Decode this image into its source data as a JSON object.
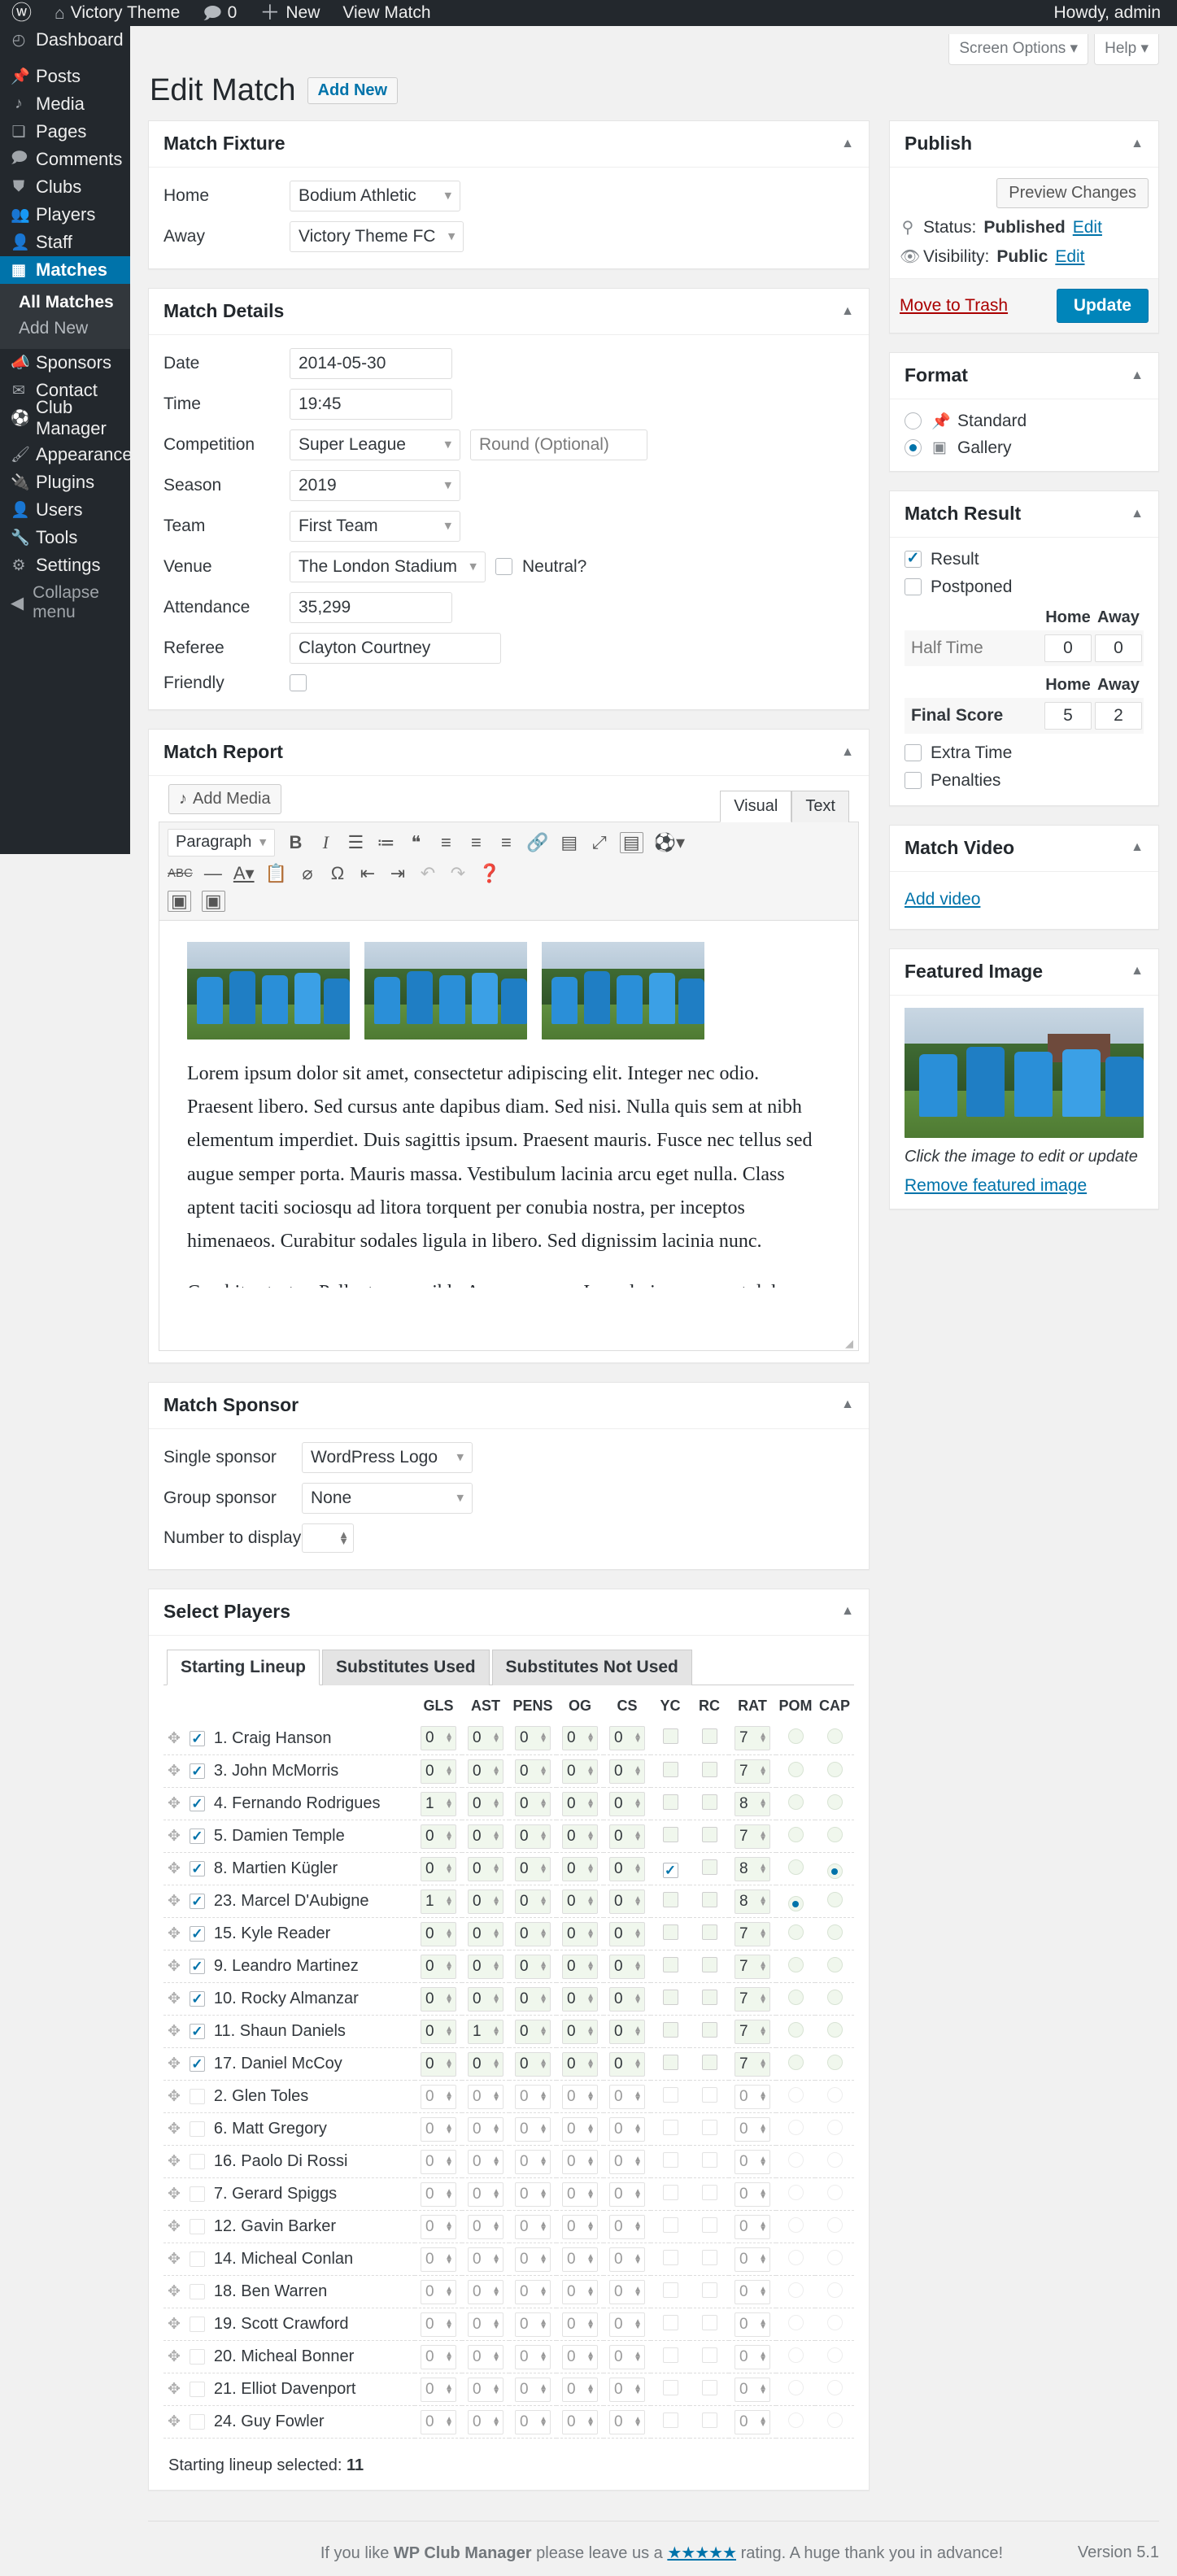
{
  "adminbar": {
    "logo_icon": "wordpress-logo-icon",
    "site_icon": "home-icon",
    "site_name": "Victory Theme",
    "comments_icon": "comment-bubble-icon",
    "comments_count": "0",
    "new_icon": "plus-icon",
    "new_label": "New",
    "view_match_label": "View Match",
    "howdy": "Howdy, admin"
  },
  "sidebar": {
    "items": [
      {
        "icon": "dashboard-icon",
        "glyph": "◴",
        "label": "Dashboard"
      },
      {
        "icon": "pin-icon",
        "glyph": "📌",
        "label": "Posts"
      },
      {
        "icon": "media-icon",
        "glyph": "♬",
        "label": "Media"
      },
      {
        "icon": "pages-icon",
        "glyph": "❏",
        "label": "Pages"
      },
      {
        "icon": "comments-icon",
        "glyph": "🗩",
        "label": "Comments"
      },
      {
        "icon": "shield-icon",
        "glyph": "⛊",
        "label": "Clubs"
      },
      {
        "icon": "players-icon",
        "glyph": "👥",
        "label": "Players"
      },
      {
        "icon": "staff-icon",
        "glyph": "👤",
        "label": "Staff"
      },
      {
        "icon": "calendar-icon",
        "glyph": "▦",
        "label": "Matches",
        "current": true
      }
    ],
    "submenu": [
      {
        "label": "All Matches",
        "current": true
      },
      {
        "label": "Add New",
        "current": false
      }
    ],
    "items_after": [
      {
        "icon": "megaphone-icon",
        "glyph": "📣",
        "label": "Sponsors"
      },
      {
        "icon": "mail-icon",
        "glyph": "✉",
        "label": "Contact"
      },
      {
        "icon": "club-manager-icon",
        "glyph": "⚽",
        "label": "Club Manager"
      }
    ],
    "items_last": [
      {
        "icon": "appearance-icon",
        "glyph": "🖌",
        "label": "Appearance"
      },
      {
        "icon": "plugins-icon",
        "glyph": "🔌",
        "label": "Plugins"
      },
      {
        "icon": "users-icon",
        "glyph": "👤",
        "label": "Users"
      },
      {
        "icon": "tools-icon",
        "glyph": "🔧",
        "label": "Tools"
      },
      {
        "icon": "settings-icon",
        "glyph": "⚙",
        "label": "Settings"
      }
    ],
    "collapse": {
      "icon": "collapse-icon",
      "glyph": "◀",
      "label": "Collapse menu"
    }
  },
  "screen_meta": {
    "screen_options": "Screen Options ▾",
    "help": "Help ▾"
  },
  "page": {
    "title": "Edit Match",
    "add_new": "Add New"
  },
  "fixture": {
    "title": "Match Fixture",
    "home_label": "Home",
    "home_value": "Bodium Athletic",
    "away_label": "Away",
    "away_value": "Victory Theme FC"
  },
  "details": {
    "title": "Match Details",
    "date_label": "Date",
    "date_value": "2014-05-30",
    "time_label": "Time",
    "time_value": "19:45",
    "competition_label": "Competition",
    "competition_value": "Super League",
    "round_placeholder": "Round (Optional)",
    "round_value": "",
    "season_label": "Season",
    "season_value": "2019",
    "team_label": "Team",
    "team_value": "First Team",
    "venue_label": "Venue",
    "venue_value": "The London Stadium",
    "neutral_label": "Neutral?",
    "neutral_checked": false,
    "attendance_label": "Attendance",
    "attendance_value": "35,299",
    "referee_label": "Referee",
    "referee_value": "Clayton Courtney",
    "friendly_label": "Friendly",
    "friendly_checked": false
  },
  "report": {
    "title": "Match Report",
    "add_media": "Add Media",
    "tab_visual": "Visual",
    "tab_text": "Text",
    "paragraph_select": "Paragraph",
    "body_paragraph": "Lorem ipsum dolor sit amet, consectetur adipiscing elit. Integer nec odio. Praesent libero. Sed cursus ante dapibus diam. Sed nisi. Nulla quis sem at nibh elementum imperdiet. Duis sagittis ipsum. Praesent mauris. Fusce nec tellus sed augue semper porta. Mauris massa. Vestibulum lacinia arcu eget nulla. Class aptent taciti sociosqu ad litora torquent per conubia nostra, per inceptos himenaeos. Curabitur sodales ligula in libero. Sed dignissim lacinia nunc.",
    "body_paragraph2": "Curabitur tortor. Pellentesque nibh. Aenean quam. In scelerisque sem at dolor."
  },
  "sponsor": {
    "title": "Match Sponsor",
    "single_label": "Single sponsor",
    "single_value": "WordPress Logo",
    "group_label": "Group sponsor",
    "group_value": "None",
    "number_label": "Number to display",
    "number_value": ""
  },
  "players": {
    "title": "Select Players",
    "tabs": [
      {
        "label": "Starting Lineup",
        "active": true
      },
      {
        "label": "Substitutes Used",
        "active": false
      },
      {
        "label": "Substitutes Not Used",
        "active": false
      }
    ],
    "columns": [
      "GLS",
      "AST",
      "PENS",
      "OG",
      "CS",
      "YC",
      "RC",
      "RAT",
      "POM",
      "CAP"
    ],
    "rows": [
      {
        "name": "1. Craig Hanson",
        "selected": true,
        "gls": "0",
        "ast": "0",
        "pens": "0",
        "og": "0",
        "cs": "0",
        "yc": false,
        "rc": false,
        "rat": "7",
        "pom": false,
        "cap": false
      },
      {
        "name": "3. John McMorris",
        "selected": true,
        "gls": "0",
        "ast": "0",
        "pens": "0",
        "og": "0",
        "cs": "0",
        "yc": false,
        "rc": false,
        "rat": "7",
        "pom": false,
        "cap": false
      },
      {
        "name": "4. Fernando Rodrigues",
        "selected": true,
        "gls": "1",
        "ast": "0",
        "pens": "0",
        "og": "0",
        "cs": "0",
        "yc": false,
        "rc": false,
        "rat": "8",
        "pom": false,
        "cap": false
      },
      {
        "name": "5. Damien Temple",
        "selected": true,
        "gls": "0",
        "ast": "0",
        "pens": "0",
        "og": "0",
        "cs": "0",
        "yc": false,
        "rc": false,
        "rat": "7",
        "pom": false,
        "cap": false
      },
      {
        "name": "8. Martien Kügler",
        "selected": true,
        "gls": "0",
        "ast": "0",
        "pens": "0",
        "og": "0",
        "cs": "0",
        "yc": true,
        "rc": false,
        "rat": "8",
        "pom": false,
        "cap": true
      },
      {
        "name": "23. Marcel D'Aubigne",
        "selected": true,
        "gls": "1",
        "ast": "0",
        "pens": "0",
        "og": "0",
        "cs": "0",
        "yc": false,
        "rc": false,
        "rat": "8",
        "pom": true,
        "cap": false
      },
      {
        "name": "15. Kyle Reader",
        "selected": true,
        "gls": "0",
        "ast": "0",
        "pens": "0",
        "og": "0",
        "cs": "0",
        "yc": false,
        "rc": false,
        "rat": "7",
        "pom": false,
        "cap": false
      },
      {
        "name": "9. Leandro Martinez",
        "selected": true,
        "gls": "0",
        "ast": "0",
        "pens": "0",
        "og": "0",
        "cs": "0",
        "yc": false,
        "rc": false,
        "rat": "7",
        "pom": false,
        "cap": false
      },
      {
        "name": "10. Rocky Almanzar",
        "selected": true,
        "gls": "0",
        "ast": "0",
        "pens": "0",
        "og": "0",
        "cs": "0",
        "yc": false,
        "rc": false,
        "rat": "7",
        "pom": false,
        "cap": false
      },
      {
        "name": "11. Shaun Daniels",
        "selected": true,
        "gls": "0",
        "ast": "1",
        "pens": "0",
        "og": "0",
        "cs": "0",
        "yc": false,
        "rc": false,
        "rat": "7",
        "pom": false,
        "cap": false
      },
      {
        "name": "17. Daniel McCoy",
        "selected": true,
        "gls": "0",
        "ast": "0",
        "pens": "0",
        "og": "0",
        "cs": "0",
        "yc": false,
        "rc": false,
        "rat": "7",
        "pom": false,
        "cap": false
      },
      {
        "name": "2. Glen Toles",
        "selected": false,
        "gls": "0",
        "ast": "0",
        "pens": "0",
        "og": "0",
        "cs": "0",
        "yc": false,
        "rc": false,
        "rat": "0",
        "pom": false,
        "cap": false
      },
      {
        "name": "6. Matt Gregory",
        "selected": false,
        "gls": "0",
        "ast": "0",
        "pens": "0",
        "og": "0",
        "cs": "0",
        "yc": false,
        "rc": false,
        "rat": "0",
        "pom": false,
        "cap": false
      },
      {
        "name": "16. Paolo Di Rossi",
        "selected": false,
        "gls": "0",
        "ast": "0",
        "pens": "0",
        "og": "0",
        "cs": "0",
        "yc": false,
        "rc": false,
        "rat": "0",
        "pom": false,
        "cap": false
      },
      {
        "name": "7. Gerard Spiggs",
        "selected": false,
        "gls": "0",
        "ast": "0",
        "pens": "0",
        "og": "0",
        "cs": "0",
        "yc": false,
        "rc": false,
        "rat": "0",
        "pom": false,
        "cap": false
      },
      {
        "name": "12. Gavin Barker",
        "selected": false,
        "gls": "0",
        "ast": "0",
        "pens": "0",
        "og": "0",
        "cs": "0",
        "yc": false,
        "rc": false,
        "rat": "0",
        "pom": false,
        "cap": false
      },
      {
        "name": "14. Micheal Conlan",
        "selected": false,
        "gls": "0",
        "ast": "0",
        "pens": "0",
        "og": "0",
        "cs": "0",
        "yc": false,
        "rc": false,
        "rat": "0",
        "pom": false,
        "cap": false
      },
      {
        "name": "18. Ben Warren",
        "selected": false,
        "gls": "0",
        "ast": "0",
        "pens": "0",
        "og": "0",
        "cs": "0",
        "yc": false,
        "rc": false,
        "rat": "0",
        "pom": false,
        "cap": false
      },
      {
        "name": "19. Scott Crawford",
        "selected": false,
        "gls": "0",
        "ast": "0",
        "pens": "0",
        "og": "0",
        "cs": "0",
        "yc": false,
        "rc": false,
        "rat": "0",
        "pom": false,
        "cap": false
      },
      {
        "name": "20. Micheal Bonner",
        "selected": false,
        "gls": "0",
        "ast": "0",
        "pens": "0",
        "og": "0",
        "cs": "0",
        "yc": false,
        "rc": false,
        "rat": "0",
        "pom": false,
        "cap": false
      },
      {
        "name": "21. Elliot Davenport",
        "selected": false,
        "gls": "0",
        "ast": "0",
        "pens": "0",
        "og": "0",
        "cs": "0",
        "yc": false,
        "rc": false,
        "rat": "0",
        "pom": false,
        "cap": false
      },
      {
        "name": "24. Guy Fowler",
        "selected": false,
        "gls": "0",
        "ast": "0",
        "pens": "0",
        "og": "0",
        "cs": "0",
        "yc": false,
        "rc": false,
        "rat": "0",
        "pom": false,
        "cap": false
      }
    ],
    "lineup_note_label": "Starting lineup selected:",
    "lineup_note_count": "11"
  },
  "publish": {
    "title": "Publish",
    "preview": "Preview Changes",
    "status_label": "Status:",
    "status_value": "Published",
    "status_edit": "Edit",
    "visibility_label": "Visibility:",
    "visibility_value": "Public",
    "visibility_edit": "Edit",
    "trash": "Move to Trash",
    "update": "Update"
  },
  "format": {
    "title": "Format",
    "options": [
      {
        "label": "Standard",
        "icon": "pin-icon",
        "glyph": "📌",
        "selected": false
      },
      {
        "label": "Gallery",
        "icon": "gallery-icon",
        "glyph": "🖼",
        "selected": true
      }
    ]
  },
  "match_result": {
    "title": "Match Result",
    "result_label": "Result",
    "result_checked": true,
    "postponed_label": "Postponed",
    "postponed_checked": false,
    "home_header": "Home",
    "away_header": "Away",
    "half_time_label": "Half Time",
    "half_time_home": "0",
    "half_time_away": "0",
    "final_score_label": "Final Score",
    "final_home": "5",
    "final_away": "2",
    "extra_time_label": "Extra Time",
    "extra_time_checked": false,
    "penalties_label": "Penalties",
    "penalties_checked": false
  },
  "match_video": {
    "title": "Match Video",
    "add_video": "Add video"
  },
  "featured_image": {
    "title": "Featured Image",
    "caption": "Click the image to edit or update",
    "remove": "Remove featured image"
  },
  "footer": {
    "prefix": "If you like",
    "plugin": "WP Club Manager",
    "middle": "please leave us a",
    "stars": "★★★★★",
    "suffix": "rating. A huge thank you in advance!",
    "version": "Version 5.1"
  },
  "colors": {
    "accent": "#0073aa",
    "primary_button": "#0085ba",
    "danger": "#a00",
    "admin_bg": "#23282d"
  }
}
